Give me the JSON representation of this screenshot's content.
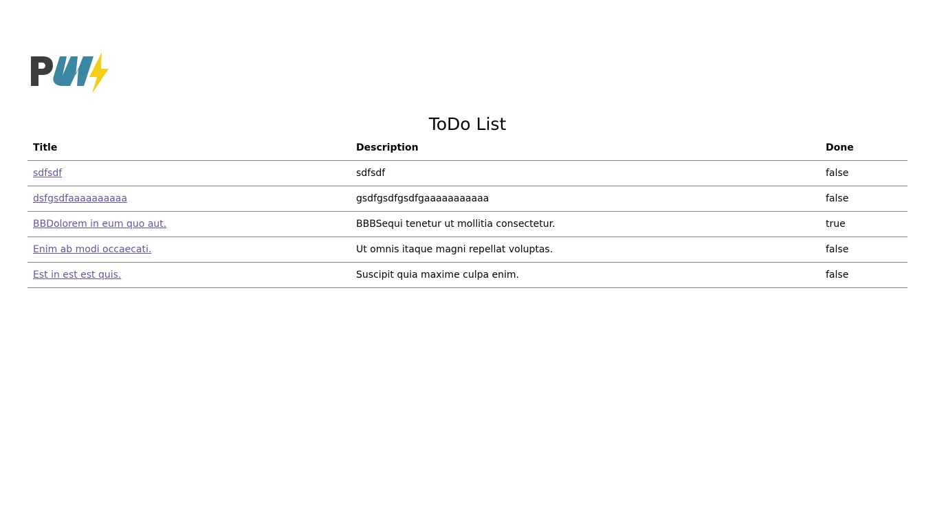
{
  "logo": {
    "alt": "PWA logo",
    "colors": {
      "p": "#3d3d3d",
      "w": "#3c87a0",
      "bolt": "#f1ce17"
    }
  },
  "page_title": "ToDo List",
  "table": {
    "headers": {
      "title": "Title",
      "description": "Description",
      "done": "Done"
    },
    "rows": [
      {
        "title": "sdfsdf",
        "description": "sdfsdf",
        "done": "false"
      },
      {
        "title": "dsfgsdfaaaaaaaaaa",
        "description": "gsdfgsdfgsdfgaaaaaaaaaaa",
        "done": "false"
      },
      {
        "title": "BBDolorem in eum quo aut.",
        "description": "BBBSequi tenetur ut mollitia consectetur.",
        "done": "true"
      },
      {
        "title": "Enim ab modi occaecati.",
        "description": "Ut omnis itaque magni repellat voluptas.",
        "done": "false"
      },
      {
        "title": "Est in est est quis.",
        "description": "Suscipit quia maxime culpa enim.",
        "done": "false"
      }
    ]
  },
  "colors": {
    "link": "#6653a6",
    "row_border": "#8a8a8a"
  }
}
